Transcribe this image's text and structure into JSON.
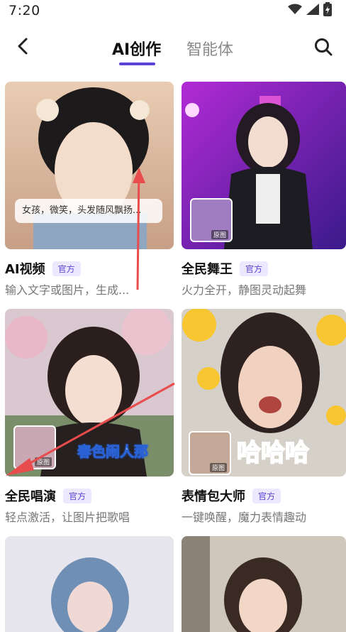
{
  "status_bar": {
    "time": "7:20",
    "icons": [
      "wifi-icon",
      "cellular-signal-icon",
      "battery-charging-icon"
    ]
  },
  "header": {
    "back_icon": "chevron-left-icon",
    "tabs": [
      {
        "label": "AI创作",
        "active": true
      },
      {
        "label": "智能体",
        "active": false
      }
    ],
    "search_icon": "search-icon"
  },
  "colors": {
    "accent": "#5b43d6",
    "badge_bg": "#ece8ff"
  },
  "cards": [
    {
      "title": "AI视频",
      "badge": "官方",
      "desc": "输入文字或图片，生成...",
      "caption": "女孩，微笑，头发随风飘扬..."
    },
    {
      "title": "全民舞王",
      "badge": "官方",
      "desc": "火力全开，静图灵动起舞",
      "mini_label": "原图"
    },
    {
      "title": "全民唱演",
      "badge": "官方",
      "desc": "轻点激活，让图片把歌唱",
      "overlay_text": "春色闹人那",
      "mini_label": "原图"
    },
    {
      "title": "表情包大师",
      "badge": "官方",
      "desc": "一键唤醒，魔力表情趣动",
      "overlay_text": "哈哈哈",
      "mini_label": "原图"
    }
  ]
}
